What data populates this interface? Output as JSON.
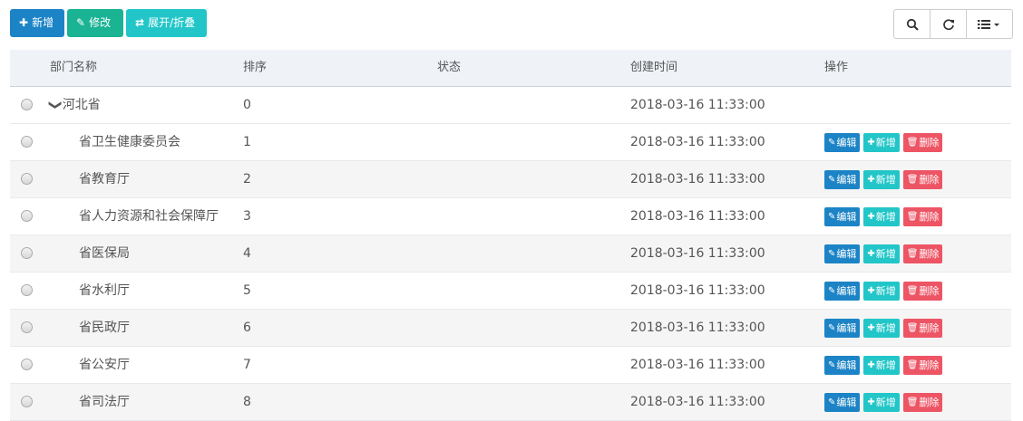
{
  "toolbar": {
    "add_label": "新增",
    "add_icon": "plus-icon",
    "edit_label": "修改",
    "edit_icon": "edit-icon",
    "expand_label": "展开/折叠",
    "expand_icon": "exchange-icon",
    "colors": {
      "add": "#1c84c6",
      "edit": "#1ab394",
      "expand": "#23c6c8"
    }
  },
  "tools": [
    "search-icon",
    "refresh-icon",
    "columns-list-icon"
  ],
  "table": {
    "headers": [
      "部门名称",
      "排序",
      "状态",
      "创建时间",
      "操作"
    ],
    "op_labels": {
      "edit": "编辑",
      "add": "新增",
      "delete": "删除"
    },
    "op_colors": {
      "edit": "#1c84c6",
      "add": "#23c6c8",
      "delete": "#ed5565"
    },
    "rows": [
      {
        "name": "河北省",
        "order": "0",
        "status": "",
        "created": "2018-03-16 11:33:00",
        "root": true
      },
      {
        "name": "省卫生健康委员会",
        "order": "1",
        "status": "",
        "created": "2018-03-16 11:33:00"
      },
      {
        "name": "省教育厅",
        "order": "2",
        "status": "",
        "created": "2018-03-16 11:33:00"
      },
      {
        "name": "省人力资源和社会保障厅",
        "order": "3",
        "status": "",
        "created": "2018-03-16 11:33:00"
      },
      {
        "name": "省医保局",
        "order": "4",
        "status": "",
        "created": "2018-03-16 11:33:00"
      },
      {
        "name": "省水利厅",
        "order": "5",
        "status": "",
        "created": "2018-03-16 11:33:00"
      },
      {
        "name": "省民政厅",
        "order": "6",
        "status": "",
        "created": "2018-03-16 11:33:00"
      },
      {
        "name": "省公安厅",
        "order": "7",
        "status": "",
        "created": "2018-03-16 11:33:00"
      },
      {
        "name": "省司法厅",
        "order": "8",
        "status": "",
        "created": "2018-03-16 11:33:00"
      }
    ]
  }
}
